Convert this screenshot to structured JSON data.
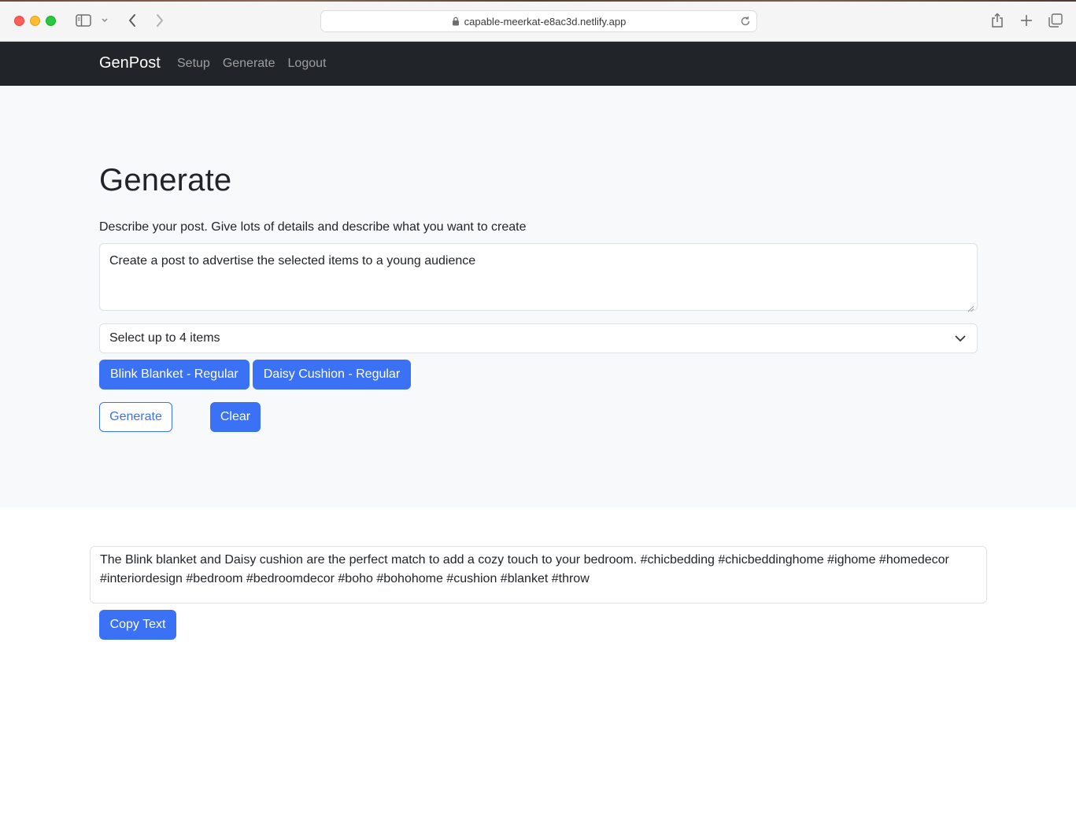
{
  "browser": {
    "url": "capable-meerkat-e8ac3d.netlify.app"
  },
  "navbar": {
    "brand": "GenPost",
    "links": [
      {
        "label": "Setup"
      },
      {
        "label": "Generate"
      },
      {
        "label": "Logout"
      }
    ]
  },
  "generate": {
    "title": "Generate",
    "prompt_label": "Describe your post. Give lots of details and describe what you want to create",
    "prompt_value": "Create a post to advertise the selected items to a young audience",
    "select_value": "Select up to 4 items",
    "selected_items": [
      {
        "label": "Blink Blanket - Regular"
      },
      {
        "label": "Daisy Cushion - Regular"
      }
    ],
    "generate_label": "Generate",
    "clear_label": "Clear"
  },
  "output": {
    "text": "The Blink blanket and Daisy cushion are the perfect match to add a cozy touch to your bedroom. #chicbedding #chicbeddinghome #ighome #homedecor #interiordesign #bedroom #bedroomdecor #boho #bohohome #cushion #blanket #throw",
    "copy_label": "Copy Text"
  },
  "colors": {
    "primary": "#3b71f5",
    "navbar_bg": "#212529",
    "hero_bg": "#f8f9fa"
  },
  "icons": {
    "browser": [
      "sidebar-icon",
      "chevron-down-icon",
      "back-icon",
      "forward-icon",
      "lock-icon",
      "reload-icon",
      "share-icon",
      "plus-icon",
      "tabs-icon"
    ],
    "select": "chevron-down-icon"
  }
}
